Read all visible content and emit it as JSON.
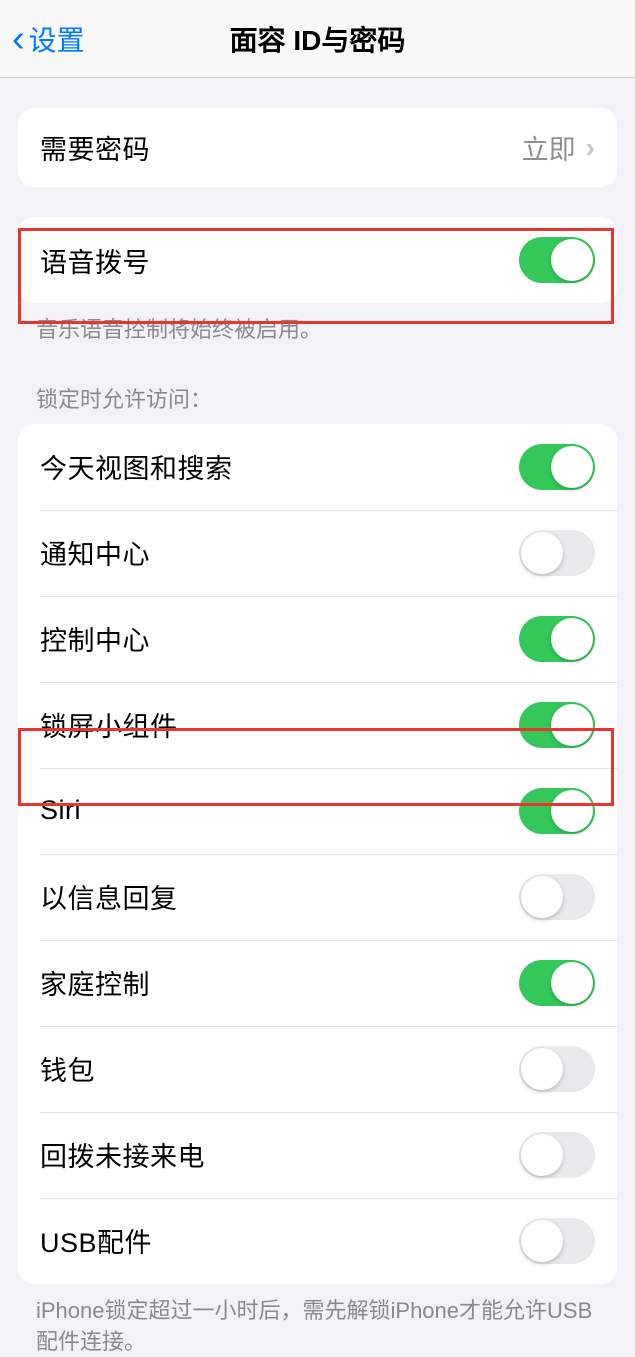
{
  "nav": {
    "back_label": "设置",
    "title": "面容 ID与密码"
  },
  "group1": {
    "row1": {
      "label": "需要密码",
      "value": "立即"
    }
  },
  "group2": {
    "row1": {
      "label": "语音拨号",
      "on": true
    },
    "footer": "音乐语音控制将始终被启用。"
  },
  "section_header": "锁定时允许访问：",
  "group3": {
    "rows": [
      {
        "label": "今天视图和搜索",
        "on": true
      },
      {
        "label": "通知中心",
        "on": false
      },
      {
        "label": "控制中心",
        "on": true
      },
      {
        "label": "锁屏小组件",
        "on": true
      },
      {
        "label": "Siri",
        "on": true
      },
      {
        "label": "以信息回复",
        "on": false
      },
      {
        "label": "家庭控制",
        "on": true
      },
      {
        "label": "钱包",
        "on": false
      },
      {
        "label": "回拨未接来电",
        "on": false
      },
      {
        "label": "USB配件",
        "on": false
      }
    ],
    "footer": "iPhone锁定超过一小时后，需先解锁iPhone才能允许USB配件连接。"
  }
}
